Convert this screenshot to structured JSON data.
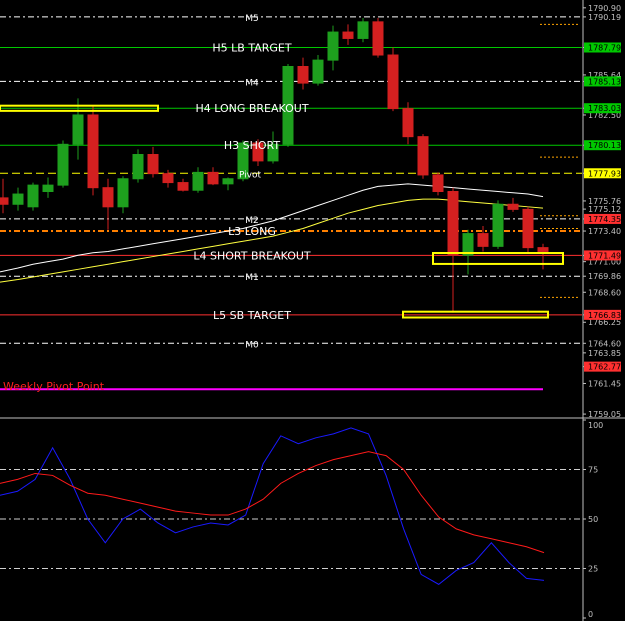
{
  "chart_data": [
    {
      "type": "candlestick",
      "price_axis": {
        "range": [
          1758.9,
          1791.2
        ],
        "tick_labels": [
          "1790.90",
          "1790.19",
          "1787.79",
          "1785.64",
          "1785.13",
          "1783.03",
          "1782.50",
          "1780.13",
          "1777.93",
          "1775.76",
          "1775.12",
          "1774.35",
          "1773.40",
          "1771.49",
          "1771.00",
          "1769.86",
          "1768.60",
          "1766.83",
          "1766.25",
          "1764.60",
          "1763.85",
          "1762.77",
          "1761.45",
          "1759.05"
        ]
      },
      "pivot_levels": [
        {
          "name": "M5",
          "value": "1790.19",
          "color": "#ffffff",
          "style": "dashdot"
        },
        {
          "name": "H5 LB TARGET",
          "value": "1787.79",
          "color": "#00c800",
          "style": "solid"
        },
        {
          "name": "M4",
          "value": "1785.13",
          "color": "#ffffff",
          "style": "dashdot"
        },
        {
          "name": "H4 LONG BREAKOUT",
          "value": "1783.03",
          "color": "#00c800",
          "style": "solid"
        },
        {
          "name": "H3 SHORT",
          "value": "1780.13",
          "color": "#00c800",
          "style": "solid"
        },
        {
          "name": "Pivot",
          "value": "1777.93",
          "color": "#ffff00",
          "style": "dashed"
        },
        {
          "name": "M2",
          "value": "1774.35",
          "color": "#ffffff",
          "style": "dashdot"
        },
        {
          "name": "L3 LONG",
          "value": "1773.40",
          "color": "#ff8000",
          "style": "dashdot"
        },
        {
          "name": "L4 SHORT BREAKOUT",
          "value": "1771.49",
          "color": "#ff3030",
          "style": "solid"
        },
        {
          "name": "M1",
          "value": "1769.86",
          "color": "#ffffff",
          "style": "dashdot"
        },
        {
          "name": "L5 SB TARGET",
          "value": "1766.83",
          "color": "#ff3030",
          "style": "solid"
        },
        {
          "name": "M0",
          "value": "1764.60",
          "color": "#ffffff",
          "style": "dashdot"
        },
        {
          "name": "Weekly Pivot Point",
          "value": "1761.00",
          "color": "#ff00ff",
          "style": "solid"
        }
      ],
      "price_badges": [
        {
          "label": "1787.79",
          "value": 1787.79,
          "bg": "#00c800",
          "fg": "#000000"
        },
        {
          "label": "1785.13",
          "value": 1785.13,
          "bg": "#00c800",
          "fg": "#000000"
        },
        {
          "label": "1783.03",
          "value": 1783.03,
          "bg": "#00c800",
          "fg": "#000000"
        },
        {
          "label": "1780.13",
          "value": 1780.13,
          "bg": "#00c800",
          "fg": "#000000"
        },
        {
          "label": "1777.93",
          "value": 1777.93,
          "bg": "#ffff00",
          "fg": "#000000"
        },
        {
          "label": "1774.35",
          "value": 1774.35,
          "bg": "#ff3030",
          "fg": "#000000"
        },
        {
          "label": "1771.49",
          "value": 1771.49,
          "bg": "#ff3030",
          "fg": "#000000"
        },
        {
          "label": "1766.83",
          "value": 1766.83,
          "bg": "#ff3030",
          "fg": "#000000"
        },
        {
          "label": "1762.77",
          "value": 1762.77,
          "bg": "#ff3030",
          "fg": "#000000"
        }
      ],
      "candles": [
        {
          "open": 1776.0,
          "high": 1777.5,
          "low": 1774.8,
          "close": 1775.5
        },
        {
          "open": 1775.5,
          "high": 1776.8,
          "low": 1775.0,
          "close": 1776.3
        },
        {
          "open": 1775.3,
          "high": 1777.2,
          "low": 1775.0,
          "close": 1777.0
        },
        {
          "open": 1776.5,
          "high": 1777.6,
          "low": 1776.0,
          "close": 1777.0
        },
        {
          "open": 1777.0,
          "high": 1780.5,
          "low": 1776.8,
          "close": 1780.2
        },
        {
          "open": 1780.2,
          "high": 1783.8,
          "low": 1779.0,
          "close": 1782.5
        },
        {
          "open": 1782.5,
          "high": 1783.2,
          "low": 1776.2,
          "close": 1776.8
        },
        {
          "open": 1776.8,
          "high": 1777.5,
          "low": 1773.5,
          "close": 1775.3
        },
        {
          "open": 1775.3,
          "high": 1777.7,
          "low": 1774.8,
          "close": 1777.5
        },
        {
          "open": 1777.5,
          "high": 1779.8,
          "low": 1777.2,
          "close": 1779.4
        },
        {
          "open": 1779.4,
          "high": 1780.0,
          "low": 1777.6,
          "close": 1777.9
        },
        {
          "open": 1777.9,
          "high": 1778.2,
          "low": 1776.8,
          "close": 1777.2
        },
        {
          "open": 1777.2,
          "high": 1777.5,
          "low": 1776.5,
          "close": 1776.6
        },
        {
          "open": 1776.6,
          "high": 1778.4,
          "low": 1776.4,
          "close": 1778.0
        },
        {
          "open": 1778.0,
          "high": 1778.4,
          "low": 1777.0,
          "close": 1777.1
        },
        {
          "open": 1777.1,
          "high": 1777.6,
          "low": 1776.6,
          "close": 1777.5
        },
        {
          "open": 1777.5,
          "high": 1780.5,
          "low": 1777.3,
          "close": 1780.3
        },
        {
          "open": 1780.3,
          "high": 1780.6,
          "low": 1778.5,
          "close": 1778.9
        },
        {
          "open": 1778.9,
          "high": 1781.2,
          "low": 1778.7,
          "close": 1780.2
        },
        {
          "open": 1780.2,
          "high": 1786.5,
          "low": 1780.0,
          "close": 1786.3
        },
        {
          "open": 1786.3,
          "high": 1787.0,
          "low": 1784.5,
          "close": 1785.0
        },
        {
          "open": 1785.0,
          "high": 1787.2,
          "low": 1784.8,
          "close": 1786.8
        },
        {
          "open": 1786.8,
          "high": 1789.5,
          "low": 1786.0,
          "close": 1789.0
        },
        {
          "open": 1789.0,
          "high": 1789.6,
          "low": 1788.0,
          "close": 1788.5
        },
        {
          "open": 1788.5,
          "high": 1790.1,
          "low": 1788.2,
          "close": 1789.8
        },
        {
          "open": 1789.8,
          "high": 1790.1,
          "low": 1787.0,
          "close": 1787.2
        },
        {
          "open": 1787.2,
          "high": 1787.8,
          "low": 1782.8,
          "close": 1783.0
        },
        {
          "open": 1783.0,
          "high": 1783.5,
          "low": 1780.2,
          "close": 1780.8
        },
        {
          "open": 1780.8,
          "high": 1781.0,
          "low": 1777.5,
          "close": 1777.8
        },
        {
          "open": 1777.8,
          "high": 1778.0,
          "low": 1776.2,
          "close": 1776.5
        },
        {
          "open": 1776.5,
          "high": 1776.8,
          "low": 1767.0,
          "close": 1771.5
        },
        {
          "open": 1771.5,
          "high": 1773.5,
          "low": 1770.0,
          "close": 1773.2
        },
        {
          "open": 1773.2,
          "high": 1773.8,
          "low": 1771.8,
          "close": 1772.2
        },
        {
          "open": 1772.2,
          "high": 1775.8,
          "low": 1772.0,
          "close": 1775.5
        },
        {
          "open": 1775.5,
          "high": 1776.0,
          "low": 1774.9,
          "close": 1775.1
        },
        {
          "open": 1775.1,
          "high": 1775.3,
          "low": 1771.7,
          "close": 1772.1
        },
        {
          "open": 1772.1,
          "high": 1772.4,
          "low": 1770.4,
          "close": 1771.8
        }
      ],
      "moving_averages": [
        {
          "name": "",
          "color": "#ffffff",
          "values": [
            1770.2,
            1770.5,
            1770.8,
            1771.0,
            1771.2,
            1771.5,
            1771.7,
            1771.8,
            1772.0,
            1772.2,
            1772.4,
            1772.6,
            1772.8,
            1773.0,
            1773.2,
            1773.4,
            1773.6,
            1773.9,
            1774.2,
            1774.6,
            1775.0,
            1775.4,
            1775.8,
            1776.2,
            1776.6,
            1776.9,
            1777.0,
            1777.1,
            1777.0,
            1776.9,
            1776.8,
            1776.7,
            1776.6,
            1776.5,
            1776.4,
            1776.3,
            1776.1
          ]
        },
        {
          "name": "",
          "color": "#ffff40",
          "values": [
            1769.4,
            1769.6,
            1769.8,
            1770.0,
            1770.2,
            1770.4,
            1770.6,
            1770.8,
            1771.0,
            1771.2,
            1771.4,
            1771.6,
            1771.8,
            1772.0,
            1772.2,
            1772.4,
            1772.6,
            1772.8,
            1773.0,
            1773.3,
            1773.6,
            1774.0,
            1774.4,
            1774.8,
            1775.1,
            1775.4,
            1775.6,
            1775.8,
            1775.9,
            1775.9,
            1775.8,
            1775.7,
            1775.6,
            1775.5,
            1775.4,
            1775.3,
            1775.2
          ]
        }
      ],
      "boxes": [
        {
          "from": 0,
          "to": 10,
          "y1": 1782.9,
          "y2": 1783.15,
          "color": "#ffff00"
        },
        {
          "from": 29,
          "to": 37,
          "y1": 1770.9,
          "y2": 1771.6,
          "color": "#ffff00"
        },
        {
          "from": 27,
          "to": 36,
          "y1": 1766.7,
          "y2": 1767.0,
          "color": "#ffff00"
        }
      ],
      "short_marks": [
        {
          "value": 1789.6,
          "color": "#ffa500"
        },
        {
          "value": 1779.2,
          "color": "#ffa500"
        },
        {
          "value": 1773.6,
          "color": "#ffa500"
        },
        {
          "value": 1768.2,
          "color": "#ffa500"
        },
        {
          "value": 1774.6,
          "color": "#ffa500"
        }
      ]
    },
    {
      "type": "line",
      "y_axis": {
        "range": [
          0,
          100
        ],
        "tick_labels": [
          "100",
          "75",
          "50",
          "25",
          "0"
        ]
      },
      "gridlines": [
        75,
        50,
        25
      ],
      "series": [
        {
          "name": "",
          "color": "#1a1aff",
          "values": [
            62,
            64,
            70,
            86,
            70,
            50,
            38,
            50,
            55,
            48,
            43,
            46,
            48,
            47,
            52,
            78,
            92,
            88,
            91,
            93,
            96,
            93,
            72,
            45,
            22,
            17,
            24,
            28,
            38,
            28,
            20,
            19
          ]
        },
        {
          "name": "",
          "color": "#ff1a1a",
          "values": [
            68,
            70,
            73,
            72,
            67,
            63,
            62,
            60,
            58,
            56,
            54,
            53,
            52,
            52,
            55,
            60,
            68,
            73,
            77,
            80,
            82,
            84,
            82,
            75,
            62,
            51,
            45,
            42,
            40,
            38,
            36,
            33
          ]
        }
      ]
    }
  ]
}
